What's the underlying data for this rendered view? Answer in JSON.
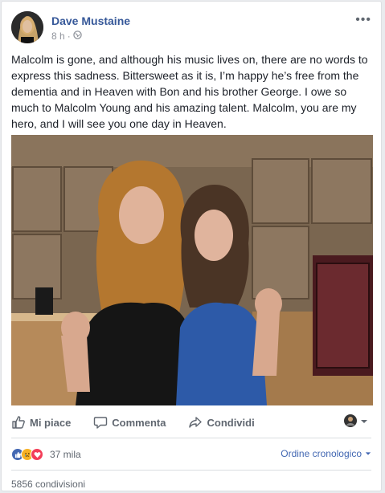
{
  "post": {
    "author": "Dave Mustaine",
    "time": "8 h",
    "text": "Malcolm is gone, and although his music lives on, there are no words to express this sadness. Bittersweet as it is, I’m happy he’s free from the dementia and in Heaven with Bon and his brother George. I owe so much to Malcolm Young and his amazing talent. Malcolm, you are my hero, and I will see you one day in Heaven."
  },
  "actions": {
    "like": "Mi piace",
    "comment": "Commenta",
    "share": "Condividi"
  },
  "footer": {
    "reactions_count": "37 mila",
    "order_label": "Ordine cronologico",
    "shares": "5856 condivisioni"
  },
  "colors": {
    "link": "#365899",
    "like_blue": "#4267b2",
    "love_red": "#f33e58",
    "sad_yellow": "#f7b125"
  }
}
